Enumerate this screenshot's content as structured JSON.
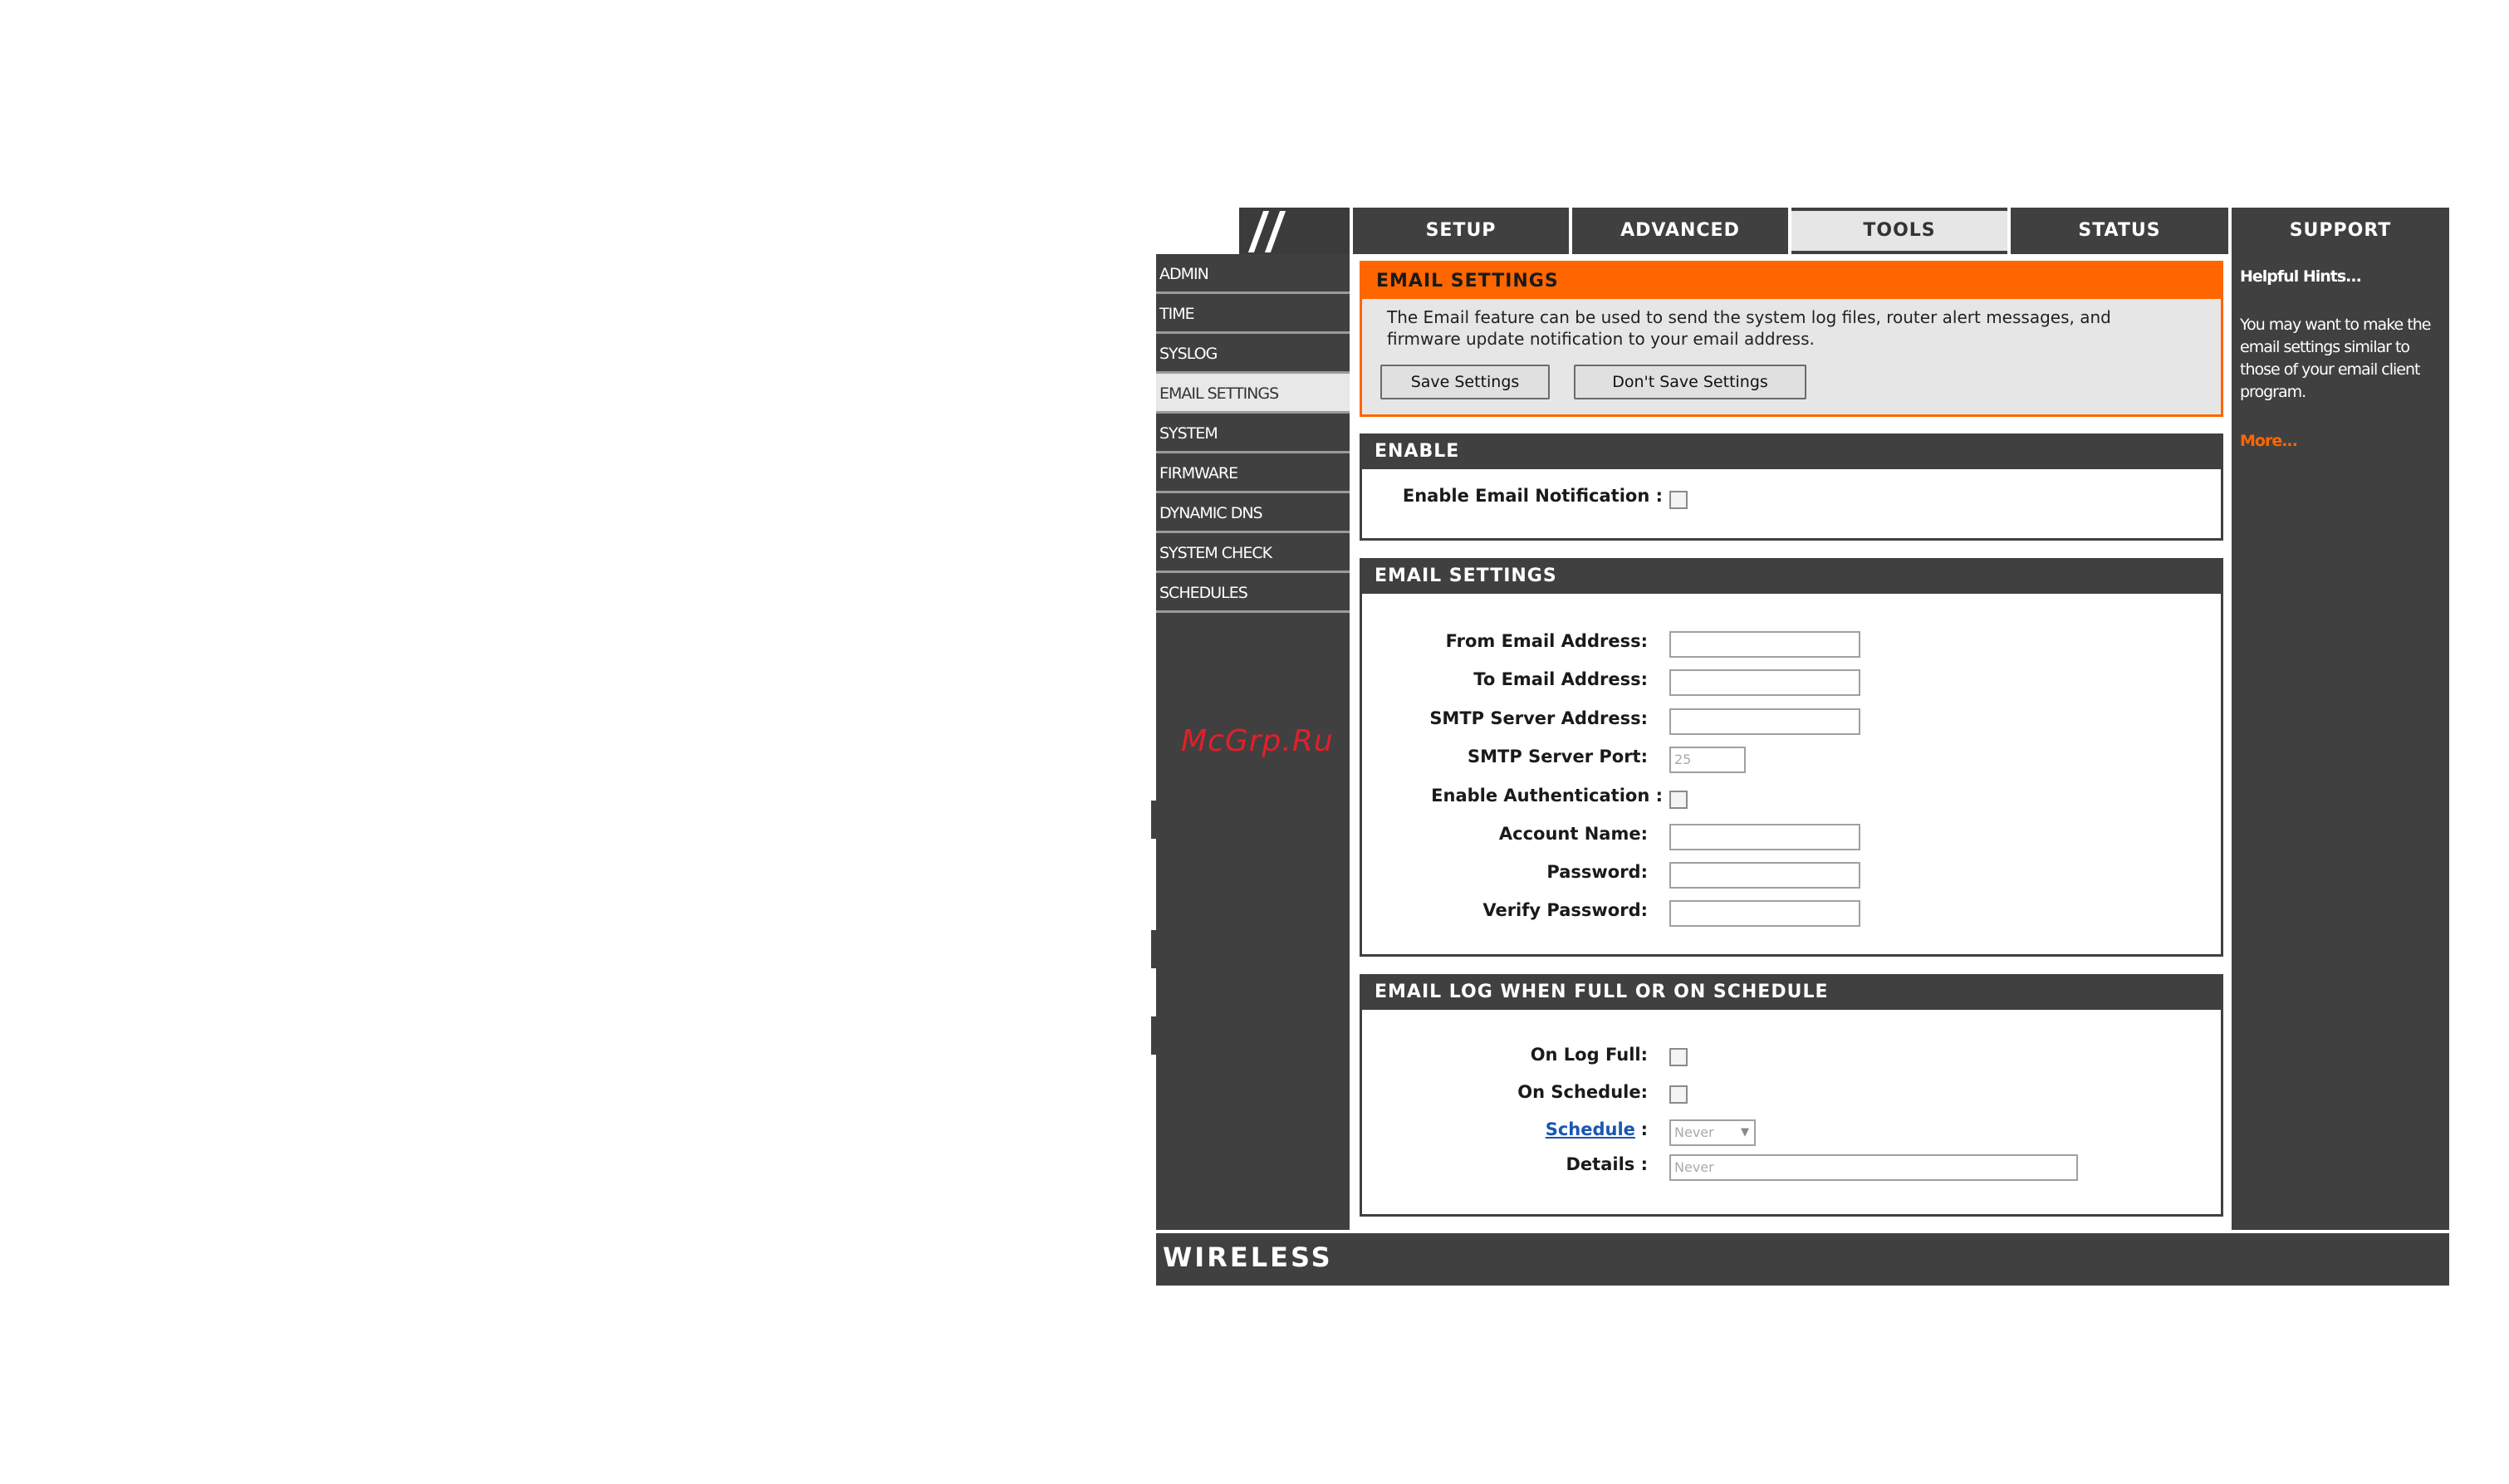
{
  "nav": {
    "tabs": [
      {
        "label": "SETUP"
      },
      {
        "label": "ADVANCED"
      },
      {
        "label": "TOOLS"
      },
      {
        "label": "STATUS"
      },
      {
        "label": "SUPPORT"
      }
    ]
  },
  "sidebar": {
    "items": [
      {
        "label": "ADMIN"
      },
      {
        "label": "TIME"
      },
      {
        "label": "SYSLOG"
      },
      {
        "label": "EMAIL SETTINGS"
      },
      {
        "label": "SYSTEM"
      },
      {
        "label": "FIRMWARE"
      },
      {
        "label": "DYNAMIC DNS"
      },
      {
        "label": "SYSTEM CHECK"
      },
      {
        "label": "SCHEDULES"
      }
    ]
  },
  "intro": {
    "title": "EMAIL SETTINGS",
    "text": "The Email feature can be used to send the system log files, router alert messages, and firmware update notification to your email address.",
    "save_label": "Save Settings",
    "dont_save_label": "Don't Save Settings"
  },
  "enable": {
    "title": "ENABLE",
    "notification_label": "Enable Email Notification :"
  },
  "email_settings": {
    "title": "EMAIL SETTINGS",
    "from_label": "From Email Address:",
    "to_label": "To Email Address:",
    "smtp_label": "SMTP Server Address:",
    "port_label": "SMTP Server Port:",
    "port_value": "25",
    "auth_label": "Enable Authentication :",
    "account_label": "Account Name:",
    "password_label": "Password:",
    "verify_label": "Verify Password:"
  },
  "email_log": {
    "title": "EMAIL LOG WHEN FULL OR ON SCHEDULE",
    "log_full_label": "On Log Full:",
    "on_schedule_label": "On Schedule:",
    "schedule_link": "Schedule",
    "schedule_colon": ":",
    "schedule_value": "Never",
    "details_label": "Details :",
    "details_value": "Never"
  },
  "hints": {
    "title": "Helpful Hints...",
    "text": "You may want to make the email settings similar to those of your email client program.",
    "more": "More..."
  },
  "footer": {
    "brand": "WIRELESS"
  },
  "watermark": "McGrp.Ru",
  "colors": {
    "orange": "#ff6600",
    "dark": "#404040",
    "link": "#1a56b0",
    "watermark": "#e0202a"
  }
}
